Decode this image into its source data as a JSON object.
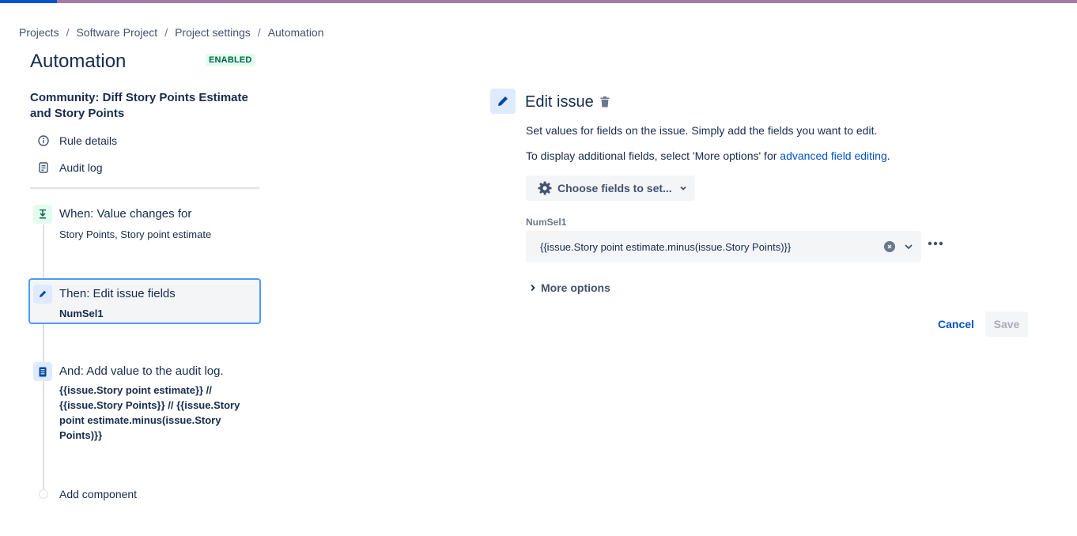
{
  "breadcrumb": {
    "items": [
      "Projects",
      "Software Project",
      "Project settings",
      "Automation"
    ],
    "separator": "/"
  },
  "page": {
    "title": "Automation",
    "status_badge": "ENABLED"
  },
  "rule": {
    "name": "Community: Diff Story Points Estimate and Story Points",
    "links": {
      "rule_details": "Rule details",
      "audit_log": "Audit log"
    }
  },
  "components": {
    "when": {
      "title": "When: Value changes for",
      "subtitle": "Story Points, Story point estimate",
      "icon": "field-change-icon"
    },
    "then": {
      "title": "Then: Edit issue fields",
      "subtitle": "NumSel1",
      "icon": "pencil-icon"
    },
    "and": {
      "title": "And: Add value to the audit log.",
      "subtitle": "{{issue.Story point estimate}} // {{issue.Story Points}} // {{issue.Story point estimate.minus(issue.Story Points)}}",
      "icon": "audit-log-icon"
    },
    "add_component": "Add component"
  },
  "editor": {
    "title": "Edit issue",
    "description1": "Set values for fields on the issue. Simply add the fields you want to edit.",
    "description2_prefix": "To display additional fields, select 'More options' for ",
    "description2_link": "advanced field editing",
    "description2_suffix": ".",
    "choose_fields_label": "Choose fields to set...",
    "field": {
      "label": "NumSel1",
      "value": "{{issue.Story point estimate.minus(issue.Story Points)}}"
    },
    "more_options_label": "More options",
    "cancel_label": "Cancel",
    "save_label": "Save"
  },
  "colors": {
    "accent": "#0052cc",
    "enabled_bg": "#e3fcef",
    "enabled_text": "#006644",
    "selected_border": "#4c9aff",
    "top_bar": "#a77aa5"
  }
}
